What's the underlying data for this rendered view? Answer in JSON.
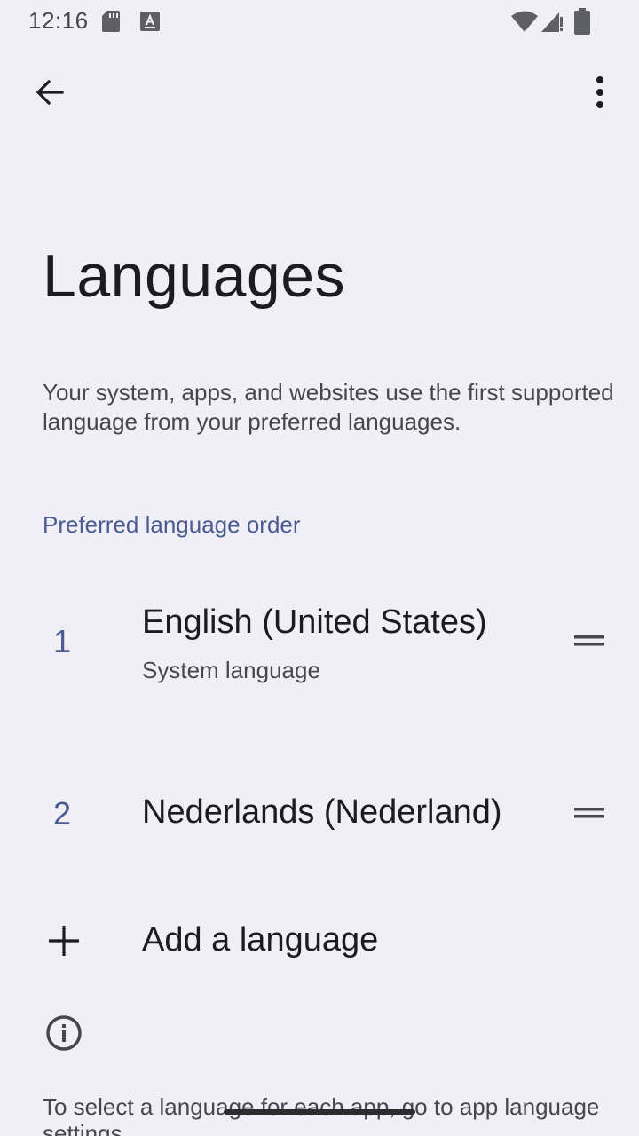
{
  "status_bar": {
    "time": "12:16",
    "icons": [
      "sd-card-icon",
      "keyboard-icon",
      "wifi-icon",
      "signal-icon",
      "battery-icon"
    ]
  },
  "app_bar": {
    "back_icon": "arrow-back-icon",
    "more_icon": "more-vert-icon"
  },
  "page": {
    "title": "Languages",
    "description": "Your system, apps, and websites use the first supported language from your preferred languages.",
    "section_header": "Preferred language order",
    "languages": [
      {
        "number": "1",
        "name": "English (United States)",
        "subtitle": "System language"
      },
      {
        "number": "2",
        "name": "Nederlands (Nederland)",
        "subtitle": ""
      }
    ],
    "add_language_label": "Add a language",
    "footer_text": "To select a language for each app, go to app language settings."
  },
  "colors": {
    "background": "#efeff5",
    "accent": "#4c5a92",
    "primary_text": "#1b1b21",
    "secondary_text": "#46464f"
  }
}
